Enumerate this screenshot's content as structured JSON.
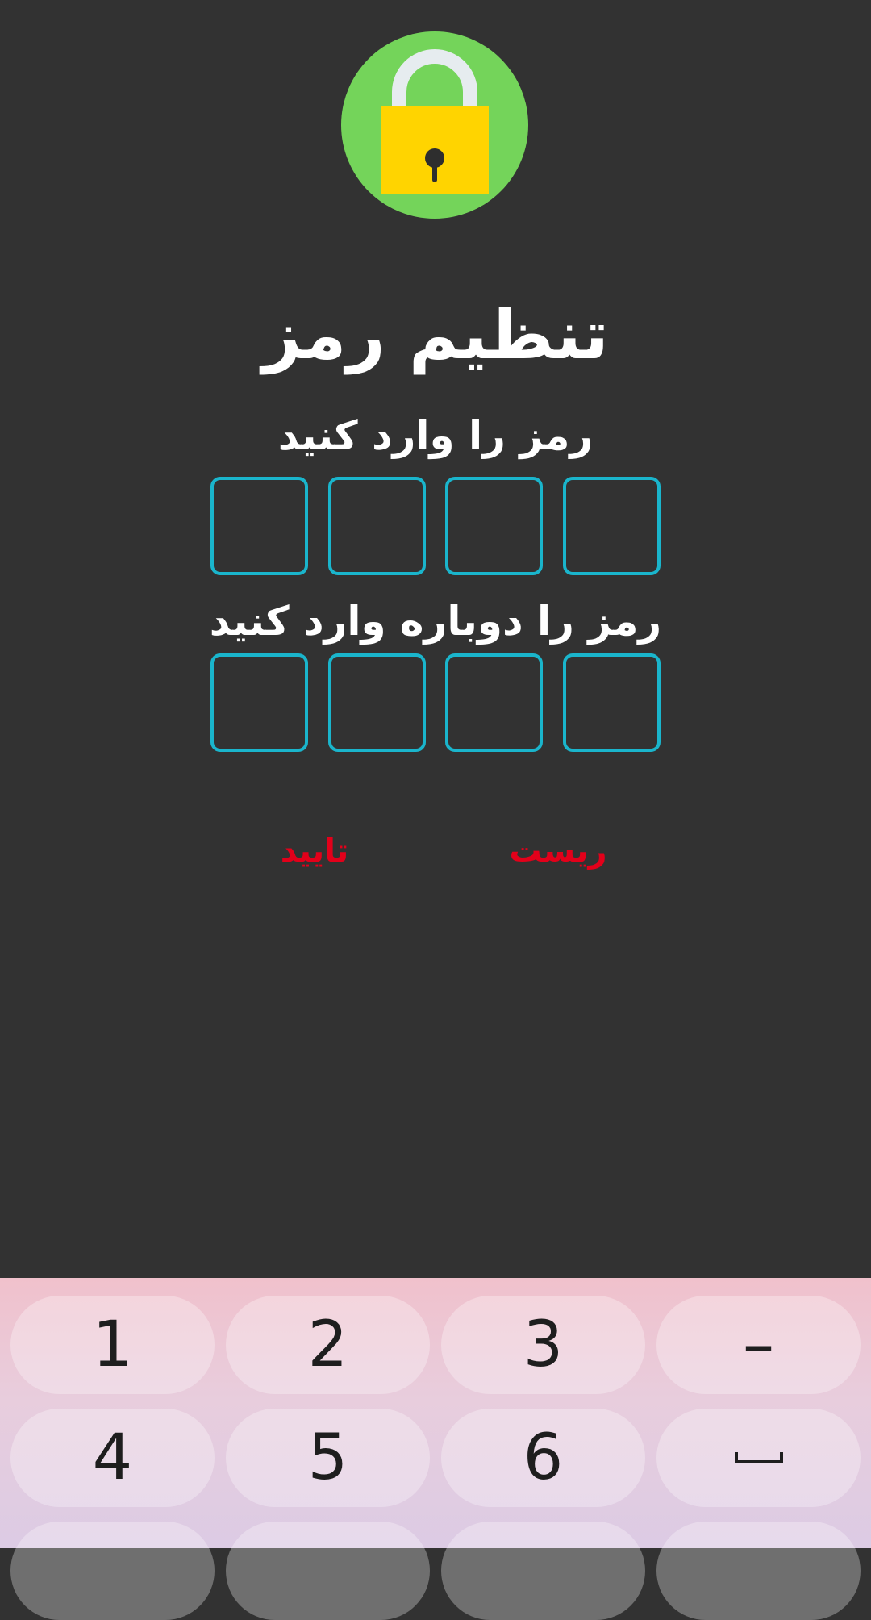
{
  "app": {
    "title": "تنظیم رمز",
    "enter_label": "رمز را  وارد کنید",
    "reenter_label": "رمز را  دوباره وارد کنید",
    "confirm_label": "تایید",
    "reset_label": "ریست",
    "pin_length": 4
  },
  "colors": {
    "background": "#323232",
    "pin_border": "#1ab5cc",
    "action_text": "#e3001a",
    "lock_circle": "#74d45a",
    "lock_body": "#ffd400"
  },
  "icons": {
    "lock": "lock-icon",
    "space": "space-key-icon"
  },
  "keyboard": {
    "row1": [
      "1",
      "2",
      "3",
      "–"
    ],
    "row2": [
      "4",
      "5",
      "6",
      "space"
    ]
  }
}
